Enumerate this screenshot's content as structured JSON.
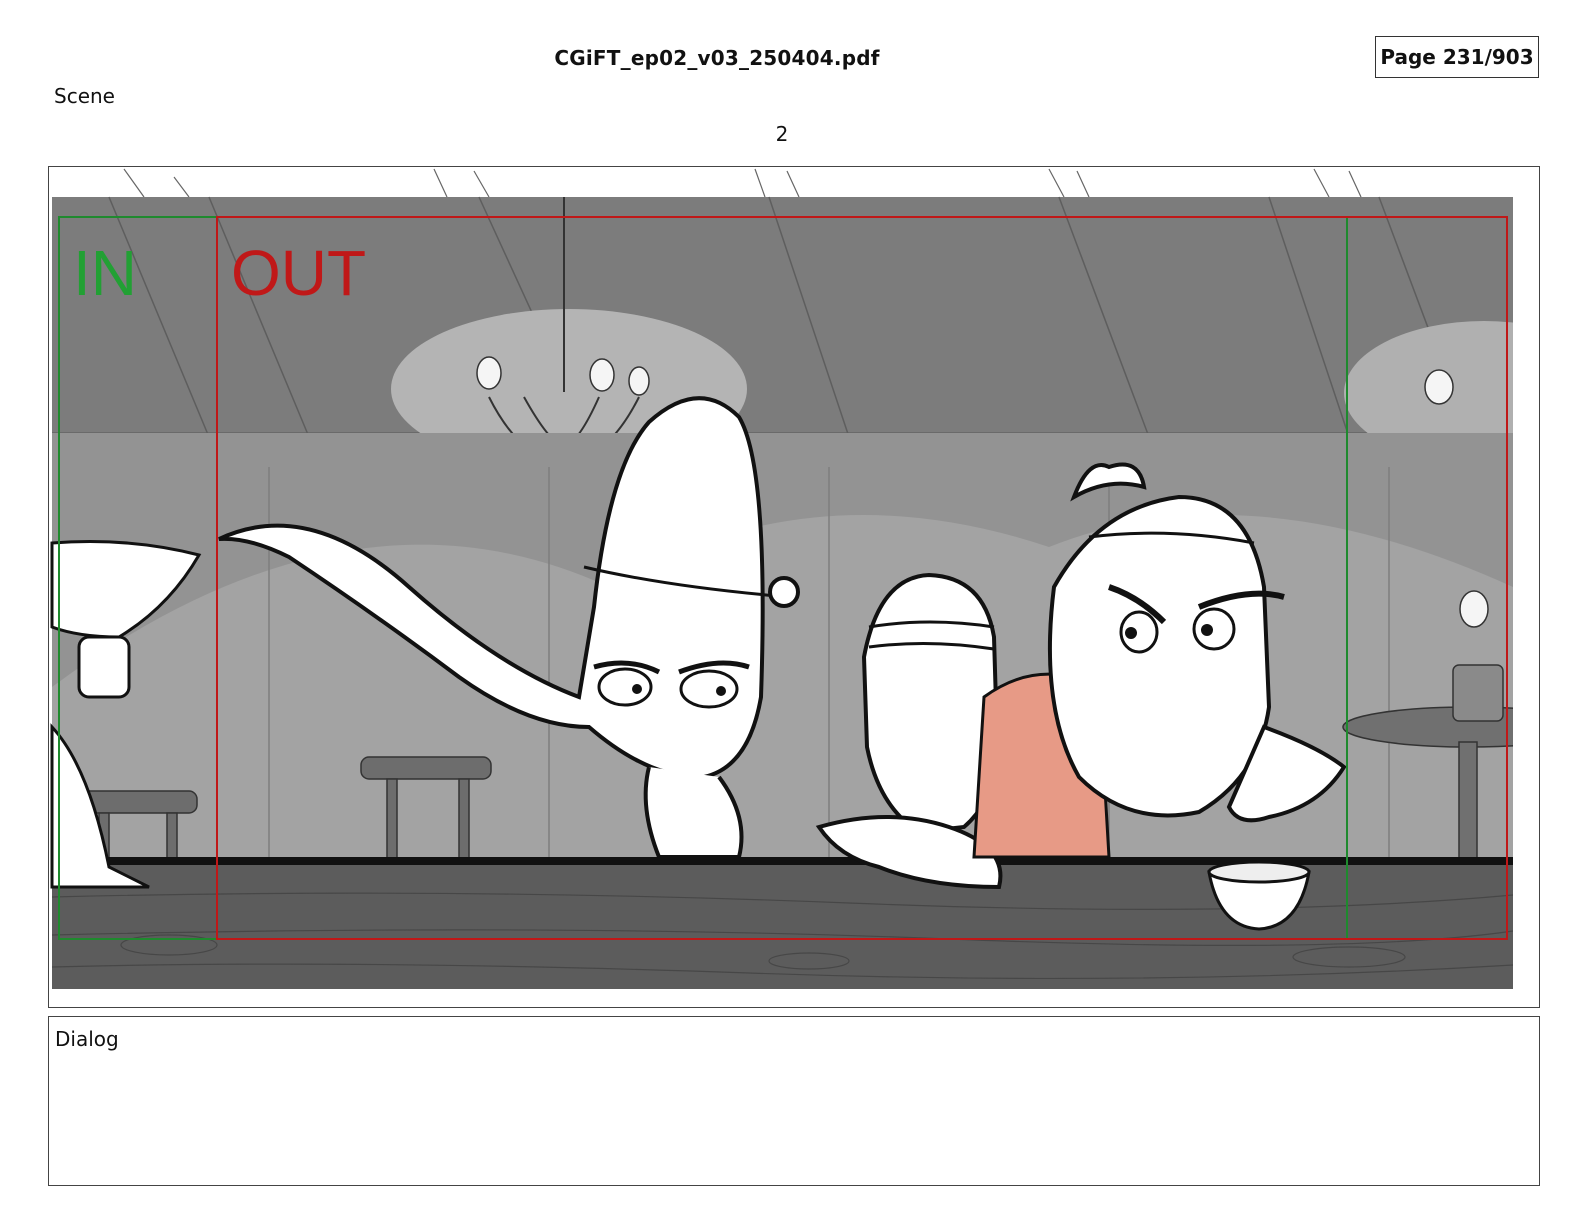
{
  "header": {
    "file_name": "CGiFT_ep02_v03_250404.pdf",
    "page_counter": "Page 231/903"
  },
  "scene": {
    "label": "Scene",
    "number": "2"
  },
  "panel": {
    "in_marker": "IN",
    "out_marker": "OUT",
    "colors": {
      "in_frame": "#1f8a2e",
      "out_frame": "#c01818",
      "background": "#8c8c8c",
      "counter": "#5a5a5a",
      "shirt_tint": "#e79a86"
    }
  },
  "dialog": {
    "label": "Dialog",
    "text": ""
  }
}
